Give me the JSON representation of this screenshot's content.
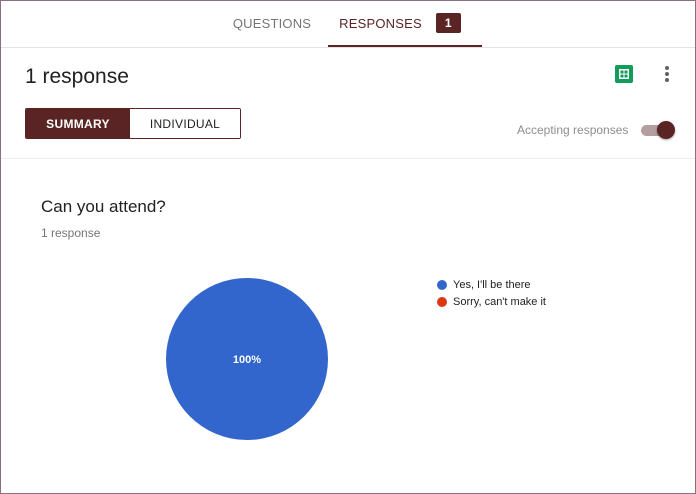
{
  "tabs": {
    "questions_label": "QUESTIONS",
    "responses_label": "RESPONSES",
    "responses_badge": "1"
  },
  "header": {
    "title": "1 response",
    "sheets_icon": "google-sheets-icon",
    "more_icon": "more-vert-icon",
    "view_toggle": {
      "summary_label": "SUMMARY",
      "individual_label": "INDIVIDUAL",
      "selected": "SUMMARY"
    },
    "accepting_label": "Accepting responses",
    "accepting_on": true
  },
  "question": {
    "title": "Can you attend?",
    "response_count": "1 response"
  },
  "chart_data": {
    "type": "pie",
    "categories": [
      "Yes, I'll be there",
      "Sorry, can't make it"
    ],
    "values": [
      100,
      0
    ],
    "slice_labels": [
      "100%",
      ""
    ],
    "colors": [
      "#3366cc",
      "#dc3912"
    ],
    "legend_position": "right"
  },
  "colors": {
    "accent": "#5b2424",
    "sheets_green": "#0f9d58"
  }
}
